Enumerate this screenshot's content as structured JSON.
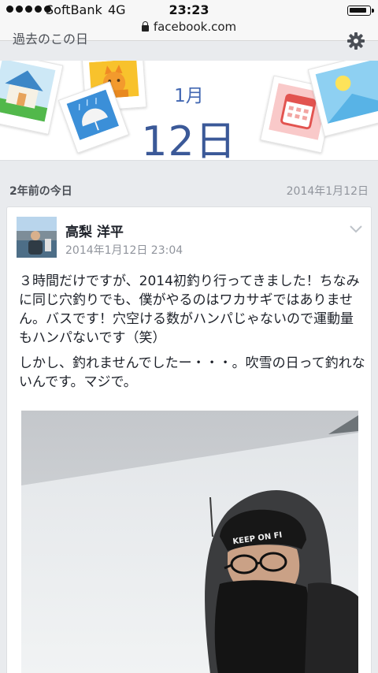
{
  "status_bar": {
    "carrier": "SoftBank",
    "network": "4G",
    "time": "23:23",
    "battery_level": 0.9
  },
  "url_bar": {
    "domain": "facebook.com"
  },
  "header": {
    "clipped_title": "過去のこの日",
    "month": "1月",
    "day": "12日"
  },
  "section": {
    "years_ago": "2年前の今日",
    "date": "2014年1月12日"
  },
  "post": {
    "author": "高梨 洋平",
    "timestamp": "2014年1月12日 23:04",
    "paragraphs": [
      "３時間だけですが、2014初釣り行ってきました！ちなみに同じ穴釣りでも、僕がやるのはワカサギではありません。バスです！穴空ける数がハンパじゃないので運動量もハンパないです（笑）",
      "しかし、釣れませんでしたー・・・。吹雪の日って釣れないんです。マジで。"
    ],
    "photo_cap_text": "KEEP ON FI"
  },
  "colors": {
    "accent": "#3b5998",
    "accent_light": "#4267b2",
    "meta_gray": "#90949c",
    "page_bg": "#e9ebee"
  },
  "icons": {
    "gear": "gear-icon",
    "chevron": "chevron-down-icon",
    "lock": "lock-icon"
  }
}
